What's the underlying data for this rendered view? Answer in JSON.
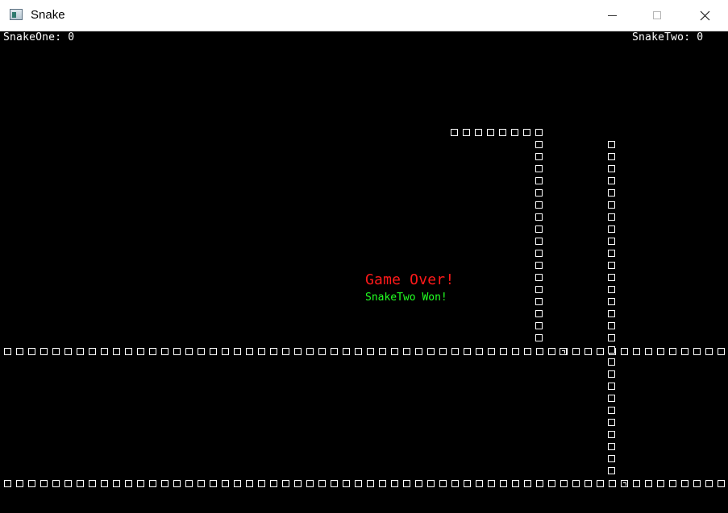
{
  "window": {
    "title": "Snake"
  },
  "titlebar": {
    "icon": "app-window-icon",
    "minimize_icon": "minimize-icon",
    "maximize_icon": "maximize-icon",
    "close_icon": "close-icon"
  },
  "hud": {
    "snake_one": "SnakeOne: 0",
    "snake_two": "SnakeTwo: 0"
  },
  "status": {
    "game_over": "Game Over!",
    "winner": "SnakeTwo Won!"
  },
  "colors": {
    "background": "#000000",
    "snake": "#ffffff",
    "game_over": "#ff1a1a",
    "winner": "#22ff22"
  }
}
